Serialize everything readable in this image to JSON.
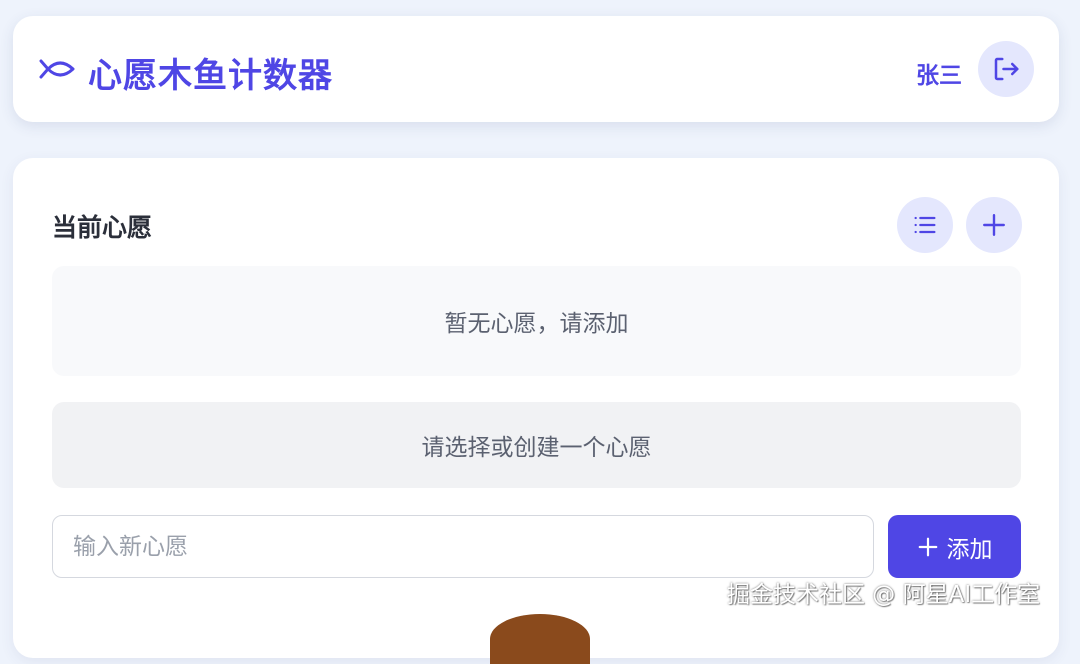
{
  "header": {
    "logo_icon": "fish-icon",
    "title": "心愿木鱼计数器",
    "username": "张三",
    "logout_icon": "logout-icon"
  },
  "wishes": {
    "section_title": "当前心愿",
    "list_icon": "list-icon",
    "add_icon": "plus-icon",
    "empty_text": "暂无心愿，请添加",
    "select_prompt": "请选择或创建一个心愿",
    "input_placeholder": "输入新心愿",
    "input_value": "",
    "add_button_label": "添加"
  },
  "watermark": "掘金技术社区 @ 阿星AI工作室",
  "colors": {
    "accent": "#4f46e5",
    "accent_light": "#e4e7fd",
    "page_bg": "#eef3fc",
    "card_bg": "#ffffff",
    "muted_text": "#5b6170",
    "wooden_fish": "#8a4a1c"
  }
}
